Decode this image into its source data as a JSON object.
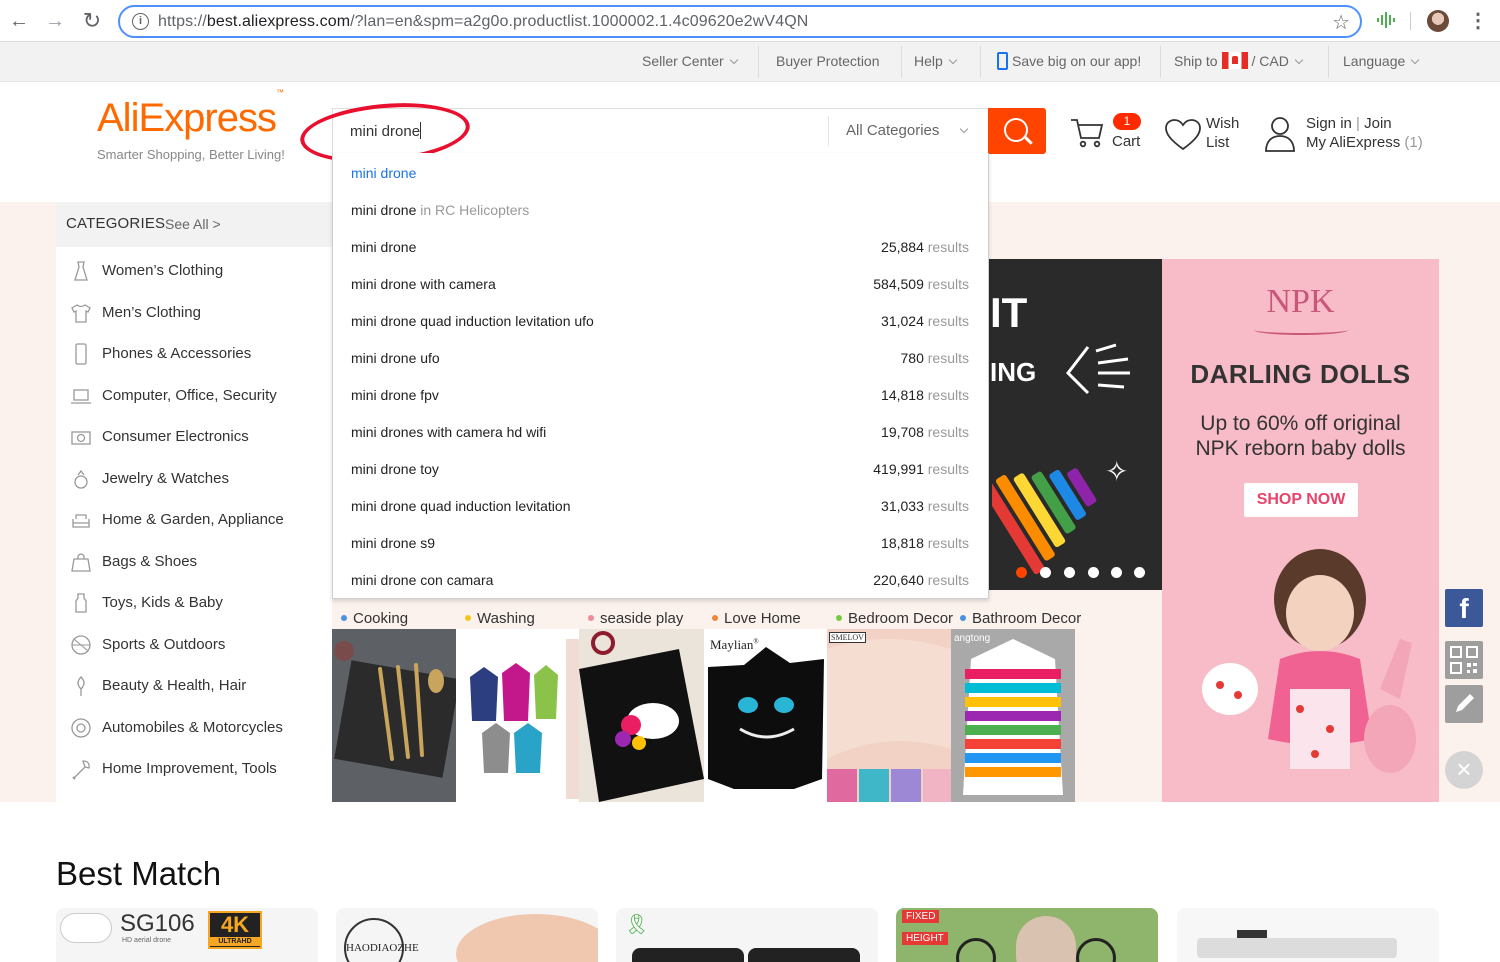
{
  "browser": {
    "url_prefix": "https://",
    "url_domain": "best.aliexpress.com",
    "url_rest": "/?lan=en&spm=a2g0o.productlist.1000002.1.4c09620e2wV4QN",
    "back_glyph": "←",
    "forward_glyph": "→",
    "reload_glyph": "↻",
    "star_glyph": "☆",
    "menu_glyph": "⋮",
    "info_glyph": "i"
  },
  "topbar": {
    "seller_center": "Seller Center",
    "buyer_protection": "Buyer Protection",
    "help": "Help",
    "app": "Save big on our app!",
    "ship_to": "Ship to",
    "currency_sep": "/",
    "currency": "CAD",
    "language": "Language"
  },
  "header": {
    "logo": "AliExpress",
    "logo_tm": "™",
    "tagline": "Smarter Shopping, Better Living!",
    "search_query": "mini drone",
    "all_categories": "All Categories",
    "cart_count": "1",
    "cart": "Cart",
    "wish": "Wish",
    "list": "List",
    "sign_in": "Sign in",
    "join": "Join",
    "my_aliexpress": "My AliExpress",
    "my_count": "(1)",
    "brand_color": "#ff6a00",
    "search_color": "#ff4400"
  },
  "categories": {
    "title": "CATEGORIES",
    "see_all": "See All >",
    "items": [
      {
        "label": "Women’s Clothing",
        "icon": "dress-icon"
      },
      {
        "label": "Men’s Clothing",
        "icon": "shirt-icon"
      },
      {
        "label": "Phones & Accessories",
        "icon": "phone-icon"
      },
      {
        "label": "Computer, Office, Security",
        "icon": "laptop-icon"
      },
      {
        "label": "Consumer Electronics",
        "icon": "camera-icon"
      },
      {
        "label": "Jewelry & Watches",
        "icon": "ring-icon"
      },
      {
        "label": "Home & Garden, Appliance",
        "icon": "sofa-icon"
      },
      {
        "label": "Bags & Shoes",
        "icon": "bag-icon"
      },
      {
        "label": "Toys, Kids & Baby",
        "icon": "bottle-icon"
      },
      {
        "label": "Sports & Outdoors",
        "icon": "ball-icon"
      },
      {
        "label": "Beauty & Health, Hair",
        "icon": "beauty-icon"
      },
      {
        "label": "Automobiles & Motorcycles",
        "icon": "wheel-icon"
      },
      {
        "label": "Home Improvement, Tools",
        "icon": "tools-icon"
      }
    ]
  },
  "suggestions": [
    {
      "text": "mini drone",
      "suffix": "",
      "count": "",
      "unit": ""
    },
    {
      "text": "mini drone",
      "suffix": " in RC Helicopters",
      "count": "",
      "unit": ""
    },
    {
      "text": "mini drone",
      "suffix": "",
      "count": "25,884",
      "unit": " results"
    },
    {
      "text": "mini drone with camera",
      "suffix": "",
      "count": "584,509",
      "unit": " results"
    },
    {
      "text": "mini drone quad induction levitation ufo",
      "suffix": "",
      "count": "31,024",
      "unit": " results"
    },
    {
      "text": "mini drone ufo",
      "suffix": "",
      "count": "780",
      "unit": " results"
    },
    {
      "text": "mini drone fpv",
      "suffix": "",
      "count": "14,818",
      "unit": " results"
    },
    {
      "text": "mini drones with camera hd wifi",
      "suffix": "",
      "count": "19,708",
      "unit": " results"
    },
    {
      "text": "mini drone toy",
      "suffix": "",
      "count": "419,991",
      "unit": " results"
    },
    {
      "text": "mini drone quad induction levitation",
      "suffix": "",
      "count": "31,033",
      "unit": " results"
    },
    {
      "text": "mini drone s9",
      "suffix": "",
      "count": "18,818",
      "unit": " results"
    },
    {
      "text": "mini drone con camara",
      "suffix": "",
      "count": "220,640",
      "unit": " results"
    }
  ],
  "banners": {
    "dark_text": "IT",
    "dark_text2": "ING",
    "npk": "NPK",
    "darling": "DARLING DOLLS",
    "upto_line1": "Up to 60% off original",
    "upto_line2": "NPK reborn baby dolls",
    "shop_now": "SHOP NOW"
  },
  "strip": [
    {
      "label": "Cooking",
      "bullet": "#4a90e2"
    },
    {
      "label": "Washing",
      "bullet": "#f5c518"
    },
    {
      "label": "seaside play",
      "bullet": "#f08a9a"
    },
    {
      "label": "Love Home",
      "bullet": "#f0853a"
    },
    {
      "label": "Bedroom Decor",
      "bullet": "#7ac943"
    },
    {
      "label": "Bathroom Decor",
      "bullet": "#4a90e2"
    }
  ],
  "tiles": {
    "maylian": "Maylian",
    "maylian_reg": "®",
    "smelov": "SMELOV",
    "angtong": "angtong"
  },
  "float": {
    "facebook": "f",
    "close": "×"
  },
  "best_match": {
    "title": "Best Match",
    "card1_model": "SG106",
    "card1_badge": "4K",
    "card1_badge_sub": "ULTRAHD",
    "card1_sub": "HD aerial drone",
    "card2_brand": "HAODIAOZHE",
    "card4_fixed": "FIXED",
    "card4_height": "HEIGHT"
  }
}
